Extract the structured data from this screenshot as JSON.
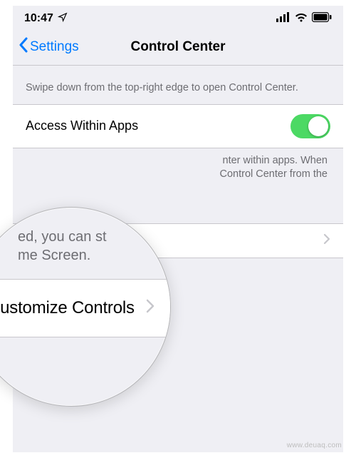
{
  "status": {
    "time": "10:47",
    "sendIcon": "location-arrow-icon"
  },
  "nav": {
    "backLabel": "Settings",
    "title": "Control Center"
  },
  "section1": {
    "desc": "Swipe down from the top-right edge to open Control Center."
  },
  "accessRow": {
    "label": "Access Within Apps",
    "toggle": true
  },
  "accessFooterLine1": "nter within apps. When",
  "accessFooterLine2": "Control Center from the",
  "customizeRow": {
    "label": "Customize Controls"
  },
  "magnifier": {
    "topLine1": "ed, you can st",
    "topLine2": "me Screen.",
    "cellLabel": "Customize Controls"
  },
  "watermark": "www.deuaq.com"
}
